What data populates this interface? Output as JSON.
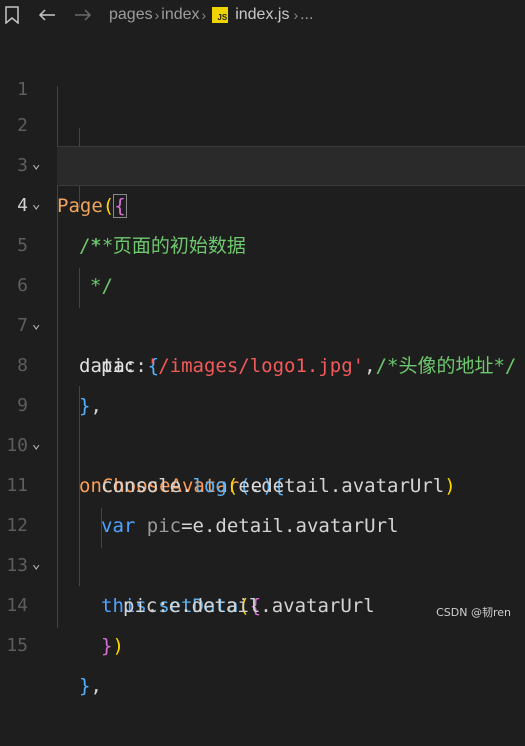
{
  "breadcrumb": {
    "items": [
      "pages",
      "index",
      "index.js",
      "..."
    ],
    "file_badge": "JS"
  },
  "editor": {
    "active_line": 4,
    "line_numbers": [
      "1",
      "2",
      "3",
      "4",
      "5",
      "6",
      "7",
      "8",
      "9",
      "10",
      "11",
      "12",
      "13",
      "14",
      "15"
    ],
    "lines": {
      "l2": {
        "fn": "Page",
        "open_paren": "(",
        "open_brace": "{"
      },
      "l3": {
        "comment": "/**"
      },
      "l4": {
        "comment": "* 页面的初始数据"
      },
      "l5": {
        "comment": "*/"
      },
      "l6": {
        "key": "data",
        "colon": ": ",
        "brace": "{"
      },
      "l7": {
        "key": "pic",
        "colon": ":",
        "string": "'/images/logo1.jpg'",
        "comma": ",",
        "comment": "/*头像的地址*/"
      },
      "l8": {
        "brace": "}",
        "comma": ","
      },
      "l9": {
        "fn": "onChooseAvatar",
        "open_paren": "(",
        "param": "e",
        "close_paren": ")",
        "brace": "{"
      },
      "l10": {
        "obj": "console",
        "dot": ".",
        "method": "log",
        "open_paren": "(",
        "arg": "e.detail.avatarUrl",
        "close_paren": ")"
      },
      "l11": {
        "kw": "var",
        "var": "pic",
        "rest": "=e.detail.avatarUrl"
      },
      "l12": {
        "kw": "this",
        "dot": ".",
        "method": "setData",
        "open_paren": "(",
        "brace": "{"
      },
      "l13": {
        "text": "pic:e.detail.avatarUrl"
      },
      "l14": {
        "brace": "}",
        "close_paren": ")"
      },
      "l15": {
        "brace": "}",
        "comma": ","
      }
    }
  },
  "watermark": "CSDN @韧ren",
  "colors": {
    "background": "#1e1e1e",
    "function": "#f0a45d",
    "comment": "#6ec86e",
    "string": "#f25a5a",
    "keyword": "#4fa3ff"
  }
}
